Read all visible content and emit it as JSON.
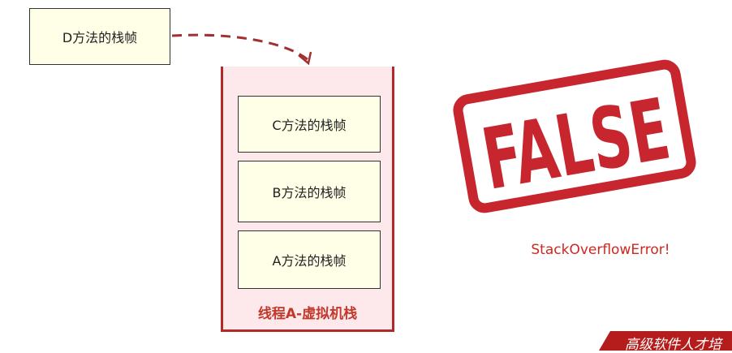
{
  "frames": {
    "d": "D方法的栈帧",
    "c": "C方法的栈帧",
    "b": "B方法的栈帧",
    "a": "A方法的栈帧"
  },
  "stack_label": "线程A-虚拟机栈",
  "stamp_text": "FALSE",
  "error_text": "StackOverflowError!",
  "banner_text": "高级软件人才培",
  "colors": {
    "stack_border": "#b02a2a",
    "stack_fill": "#fde9ec",
    "frame_fill": "#ffffe8",
    "stamp_red": "#c8262e",
    "banner": "#b51d1d"
  }
}
